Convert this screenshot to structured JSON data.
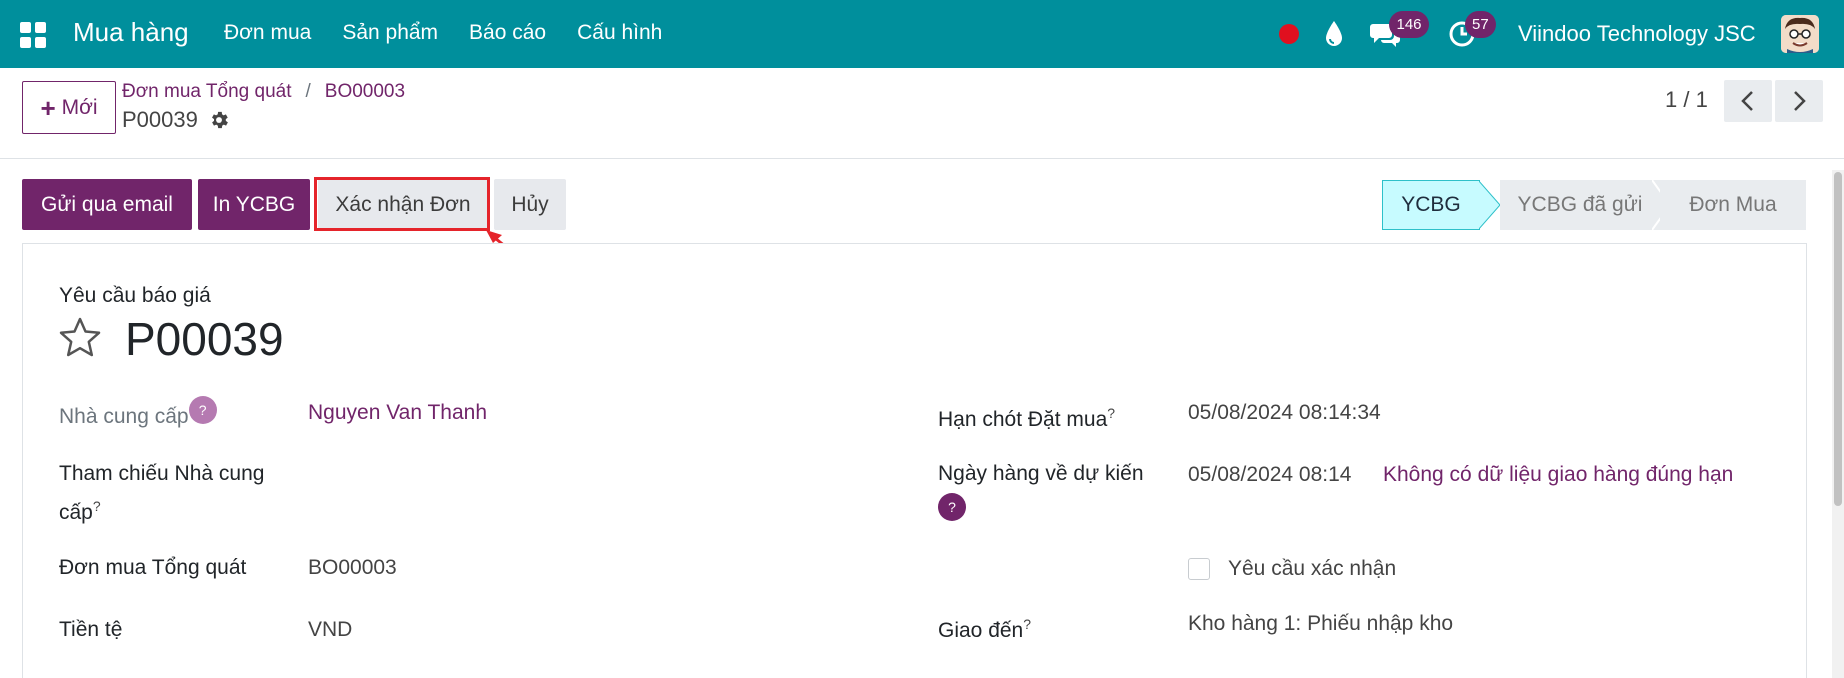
{
  "navbar": {
    "app_title": "Mua hàng",
    "menu": [
      "Đơn mua",
      "Sản phẩm",
      "Báo cáo",
      "Cấu hình"
    ],
    "chat_count": "146",
    "activity_count": "57",
    "company": "Viindoo Technology JSC",
    "icons": [
      "apps-icon",
      "record-dot-icon",
      "drop-icon",
      "chat-icon",
      "clock-icon",
      "avatar"
    ]
  },
  "control_panel": {
    "new_button": "Mới",
    "breadcrumb": {
      "parent": "Đơn mua Tổng quát",
      "sep": "/",
      "current": "BO00003"
    },
    "record_name": "P00039",
    "pager": "1 / 1"
  },
  "actions": {
    "send_email": "Gửi qua email",
    "print_rfq": "In YCBG",
    "confirm_order": "Xác nhận Đơn",
    "cancel": "Hủy"
  },
  "statusbar": {
    "stages": [
      "YCBG",
      "YCBG đã gửi",
      "Đơn Mua"
    ],
    "active": "YCBG"
  },
  "form": {
    "subtitle": "Yêu cầu báo giá",
    "title": "P00039",
    "help_mark": "?",
    "fields": {
      "vendor_label": "Nhà cung cấp",
      "vendor_value": "Nguyen Van Thanh",
      "vendor_ref_label_1": "Tham chiếu Nhà cung",
      "vendor_ref_label_2": "cấp",
      "blanket_order_label": "Đơn mua Tổng quát",
      "blanket_order_value": "BO00003",
      "currency_label": "Tiền tệ",
      "currency_value": "VND",
      "order_deadline_label": "Hạn chót Đặt mua",
      "order_deadline_value": "05/08/2024 08:14:34",
      "expected_arrival_label": "Ngày hàng về dự kiến",
      "expected_arrival_value": "05/08/2024 08:14",
      "on_time_note": "Không có dữ liệu giao hàng đúng hạn",
      "ask_confirmation_label": "Yêu cầu xác nhận",
      "deliver_to_label": "Giao đến",
      "deliver_to_value": "Kho hàng 1: Phiếu nhập kho"
    }
  },
  "colors": {
    "navbar": "#008f9c",
    "primary": "#71256a",
    "highlight": "#e5242b",
    "active_stage": "#c7fbff"
  }
}
